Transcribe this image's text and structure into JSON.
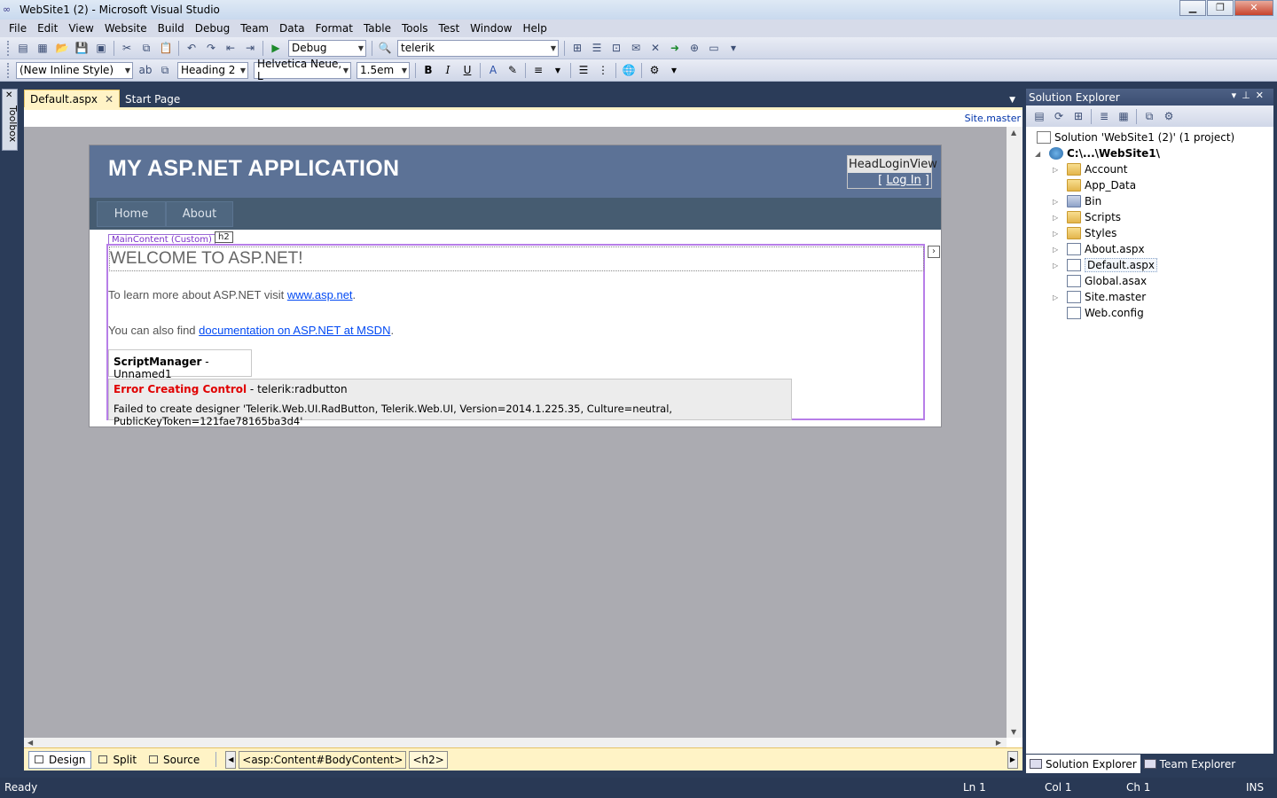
{
  "window": {
    "title": "WebSite1 (2) - Microsoft Visual Studio",
    "controls": [
      "minimize-icon",
      "maximize-icon",
      "close-icon"
    ]
  },
  "menu": [
    "File",
    "Edit",
    "View",
    "Website",
    "Build",
    "Debug",
    "Team",
    "Data",
    "Format",
    "Table",
    "Tools",
    "Test",
    "Window",
    "Help"
  ],
  "toolbar1": {
    "config": "Debug",
    "search": "telerik"
  },
  "toolbar2": {
    "style": "(New Inline Style)",
    "block_format": "Heading 2",
    "font": "Helvetica Neue, L",
    "size": "1.5em"
  },
  "toolbox": {
    "label": "Toolbox"
  },
  "tabs": [
    {
      "label": "Default.aspx",
      "active": true
    },
    {
      "label": "Start Page",
      "active": false
    }
  ],
  "editor": {
    "master_link": "Site.master",
    "page": {
      "app_title": "MY ASP.NET APPLICATION",
      "login_view_label": "HeadLoginView",
      "login_link": "Log In",
      "login_open": "[",
      "login_close": "]",
      "nav": [
        "Home",
        "About"
      ],
      "content_tag": "MainContent (Custom)",
      "h2_tag": "h2",
      "heading": "WELCOME TO ASP.NET!",
      "para1_text": "To learn more about ASP.NET visit ",
      "para1_link": "www.asp.net",
      "para1_end": ".",
      "para2_text": "You can also find ",
      "para2_link": "documentation on ASP.NET at MSDN",
      "para2_end": ".",
      "script_manager": "ScriptManager",
      "script_manager_name": " - Unnamed1",
      "error_title": "Error Creating Control",
      "error_control": " - telerik:radbutton",
      "error_detail": "Failed to create designer 'Telerik.Web.UI.RadButton, Telerik.Web.UI, Version=2014.1.225.35, Culture=neutral, PublicKeyToken=121fae78165ba3d4'"
    }
  },
  "viewbar": {
    "design": "Design",
    "split": "Split",
    "source": "Source",
    "crumb1": "<asp:Content#BodyContent>",
    "crumb2": "<h2>"
  },
  "solution_explorer": {
    "title": "Solution Explorer",
    "solution": "Solution 'WebSite1 (2)' (1 project)",
    "project": "C:\\...\\WebSite1\\",
    "items": [
      "Account",
      "App_Data",
      "Bin",
      "Scripts",
      "Styles",
      "About.aspx",
      "Default.aspx",
      "Global.asax",
      "Site.master",
      "Web.config"
    ],
    "tab_solution": "Solution Explorer",
    "tab_team": "Team Explorer"
  },
  "status": {
    "state": "Ready",
    "ln": "Ln 1",
    "col": "Col 1",
    "ch": "Ch 1",
    "mode": "INS"
  },
  "colors": {
    "header_bg": "#5c7296",
    "nav_bg": "#465c71",
    "link": "#034af3",
    "error": "#e00000",
    "content_outline": "#b77ee8"
  }
}
